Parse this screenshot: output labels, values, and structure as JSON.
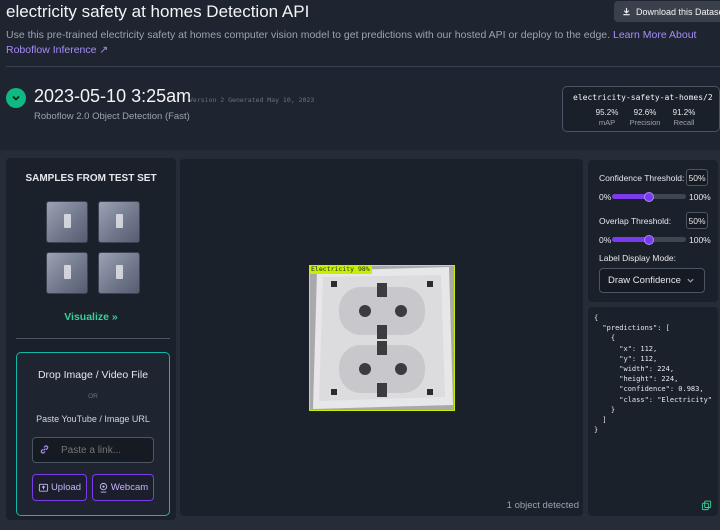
{
  "header": {
    "title": "electricity safety at homes Detection API",
    "download_label": "Download this Dataset",
    "description": "Use this pre-trained electricity safety at homes computer vision model to get predictions with our hosted API or deploy to the edge.",
    "learn_more": "Learn More About Roboflow Inference ↗"
  },
  "version": {
    "date": "2023-05-10 3:25am",
    "meta": "Version 2 Generated May 10, 2023",
    "model_type": "Roboflow 2.0 Object Detection (Fast)"
  },
  "model_card": {
    "id": "electricity-safety-at-homes/2",
    "metrics": [
      {
        "value": "95.2%",
        "label": "mAP"
      },
      {
        "value": "92.6%",
        "label": "Precision"
      },
      {
        "value": "91.2%",
        "label": "Recall"
      }
    ]
  },
  "samples": {
    "title": "SAMPLES FROM TEST SET",
    "visualize_label": "Visualize »"
  },
  "upload": {
    "drop_title": "Drop Image / Video File",
    "or": "OR",
    "paste_title": "Paste YouTube / Image URL",
    "link_placeholder": "Paste a link...",
    "upload_label": "Upload",
    "webcam_label": "Webcam"
  },
  "detection": {
    "label": "Electricity 98%",
    "object_count": "1 object detected"
  },
  "settings": {
    "confidence_label": "Confidence Threshold:",
    "confidence_value": "50%",
    "confidence_fraction": 0.5,
    "overlap_label": "Overlap Threshold:",
    "overlap_value": "50%",
    "overlap_fraction": 0.5,
    "min_label": "0%",
    "max_label": "100%",
    "label_mode_title": "Label Display Mode:",
    "label_mode_value": "Draw Confidence"
  },
  "json_output": "{\n  \"predictions\": [\n    {\n      \"x\": 112,\n      \"y\": 112,\n      \"width\": 224,\n      \"height\": 224,\n      \"confidence\": 0.983,\n      \"class\": \"Electricity\"\n    }\n  ]\n}",
  "colors": {
    "accent": "#7c3aed",
    "success": "#10b981",
    "box": "#c6f000",
    "link": "#a78bfa"
  }
}
